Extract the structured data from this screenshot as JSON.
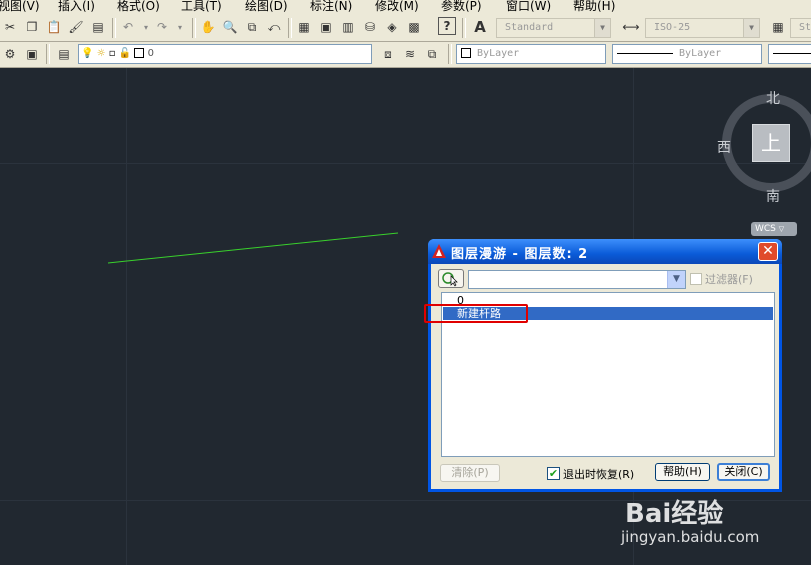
{
  "menu": [
    "视图(V)",
    "插入(I)",
    "格式(O)",
    "工具(T)",
    "绘图(D)",
    "标注(N)",
    "修改(M)",
    "参数(P)",
    "窗口(W)",
    "帮助(H)"
  ],
  "toolbar1": {
    "text_style": "Standard",
    "dim_style": "ISO-25",
    "table_style_partial": "St"
  },
  "toolbar2": {
    "layer_name": "0",
    "color": "ByLayer",
    "linetype": "ByLayer"
  },
  "viewcube": {
    "north": "北",
    "west": "西",
    "south": "南",
    "face": "上",
    "ucs": "WCS"
  },
  "dialog": {
    "title": "图层漫游 - 图层数: 2",
    "filter_label": "过滤器(F)",
    "layers": [
      "0",
      "新建杆路"
    ],
    "selected_layer": "新建杆路",
    "purge_label": "清除(P)",
    "restore_on_exit_label": "退出时恢复(R)",
    "restore_on_exit_checked": true,
    "help_label": "帮助(H)",
    "close_label": "关闭(C)"
  },
  "watermark": {
    "logo": "Bai经验",
    "url": "jingyan.baidu.com"
  },
  "colors": {
    "drawing_background": "#212830",
    "line": "#39d12c",
    "titlebar": "#0a5bd8",
    "selection": "#316ac5",
    "annotation_box": "#e00000"
  }
}
